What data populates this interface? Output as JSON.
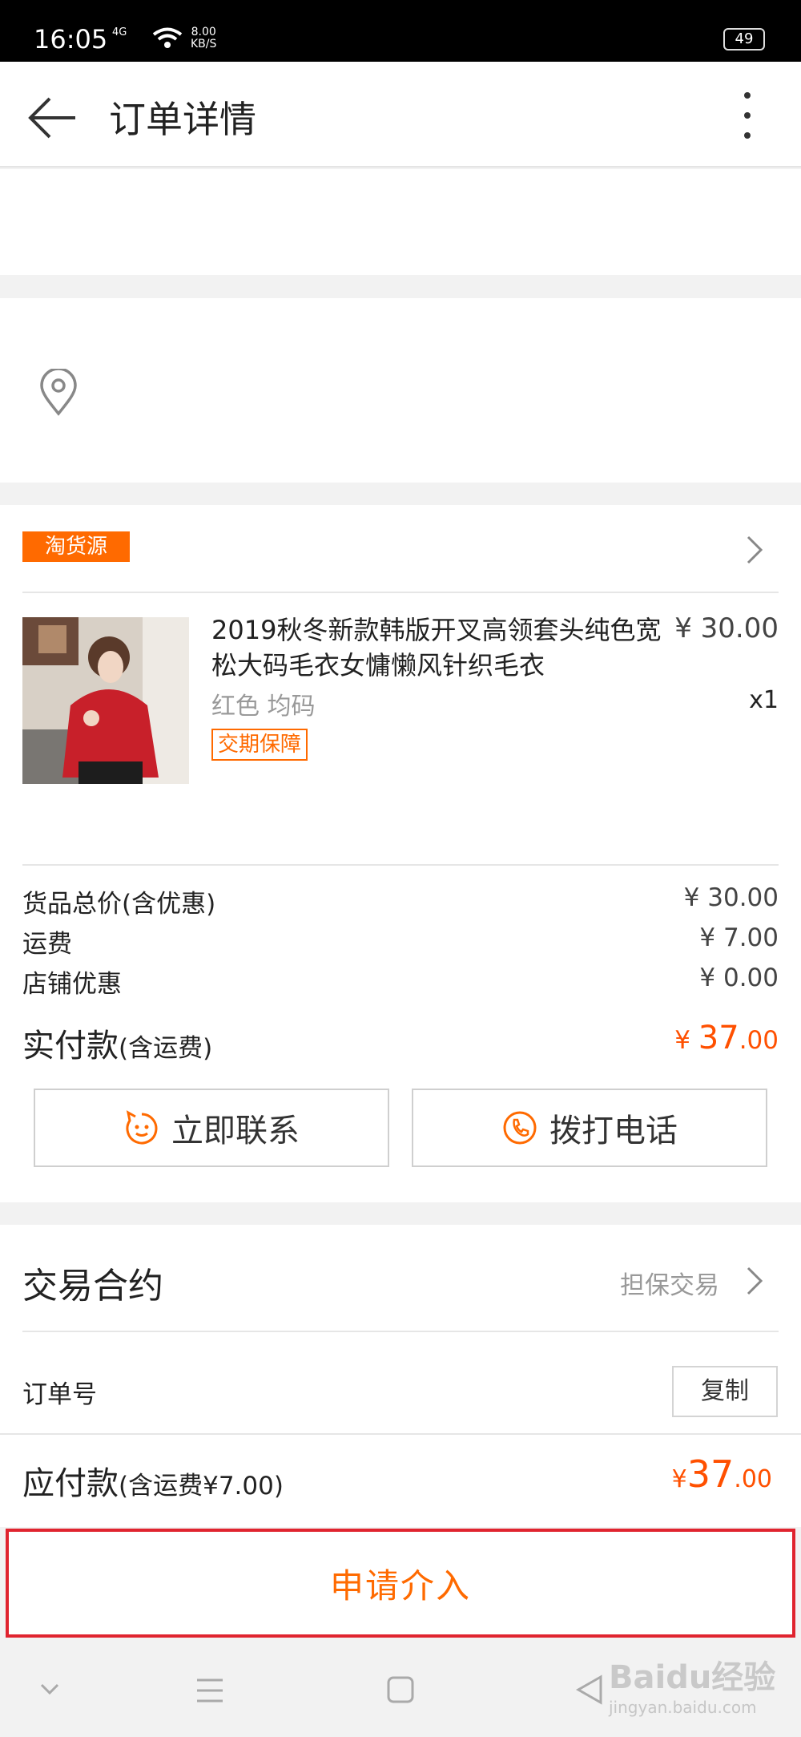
{
  "status_bar": {
    "time": "16:05",
    "network": "4G",
    "speed_value": "8.00",
    "speed_unit": "KB/S",
    "battery": "49"
  },
  "header": {
    "title": "订单详情"
  },
  "shop": {
    "tag": "淘货源"
  },
  "product": {
    "title": "2019秋冬新款韩版开叉高领套头纯色宽松大码毛衣女慵懒风针织毛衣",
    "price": "¥ 30.00",
    "spec": "红色 均码",
    "qty": "x1",
    "badge": "交期保障"
  },
  "summary": {
    "rows": [
      {
        "label": "货品总价(含优惠)",
        "value": "¥ 30.00"
      },
      {
        "label": "运费",
        "value": "¥ 7.00"
      },
      {
        "label": "店铺优惠",
        "value": "¥ 0.00"
      }
    ],
    "total_label": "实付款",
    "total_note": "(含运费)",
    "total_currency": "¥ ",
    "total_int": "37",
    "total_dec": ".00"
  },
  "actions": {
    "contact": "立即联系",
    "call": "拨打电话"
  },
  "contract": {
    "title": "交易合约",
    "type": "担保交易",
    "order_no_label": "订单号",
    "copy": "复制",
    "payable_label": "应付款",
    "payable_note": "(含运费¥7.00)",
    "payable_currency": "¥",
    "payable_int": "37",
    "payable_dec": ".00"
  },
  "apply": {
    "label": "申请介入"
  },
  "watermark": {
    "text": "Baidu经验",
    "sub": "jingyan.baidu.com"
  },
  "colors": {
    "accent": "#ff6a00",
    "price": "#ff5000",
    "highlight_border": "#e0242f"
  }
}
